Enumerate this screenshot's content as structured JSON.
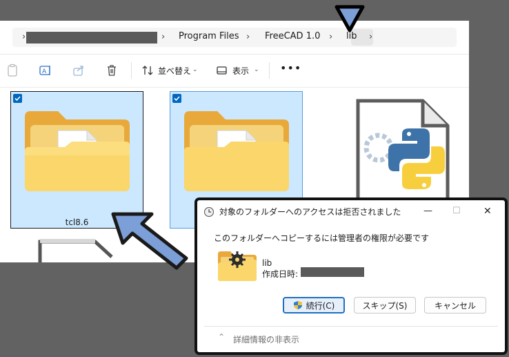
{
  "address_bar": {
    "crumbs": [
      "Program Files",
      "FreeCAD 1.0",
      "lib"
    ],
    "current": "lib"
  },
  "toolbar": {
    "sort_label": "並べ替え",
    "view_label": "表示"
  },
  "files": [
    {
      "name": "tcl8.6",
      "selected": true
    },
    {
      "name": "",
      "selected": true
    },
    {
      "name": "",
      "selected": false
    }
  ],
  "dialog": {
    "title": "対象のフォルダーへのアクセスは拒否されました",
    "message": "このフォルダーへコピーするには管理者の権限が必要です",
    "item_name": "lib",
    "created_label": "作成日時:",
    "buttons": {
      "continue": "続行(C)",
      "skip": "スキップ(S)",
      "cancel": "キャンセル"
    },
    "details_toggle": "詳細情報の非表示"
  },
  "colors": {
    "annotation_arrow": "#7b9fd6",
    "selection": "#cce8ff",
    "accent": "#0067c0"
  }
}
